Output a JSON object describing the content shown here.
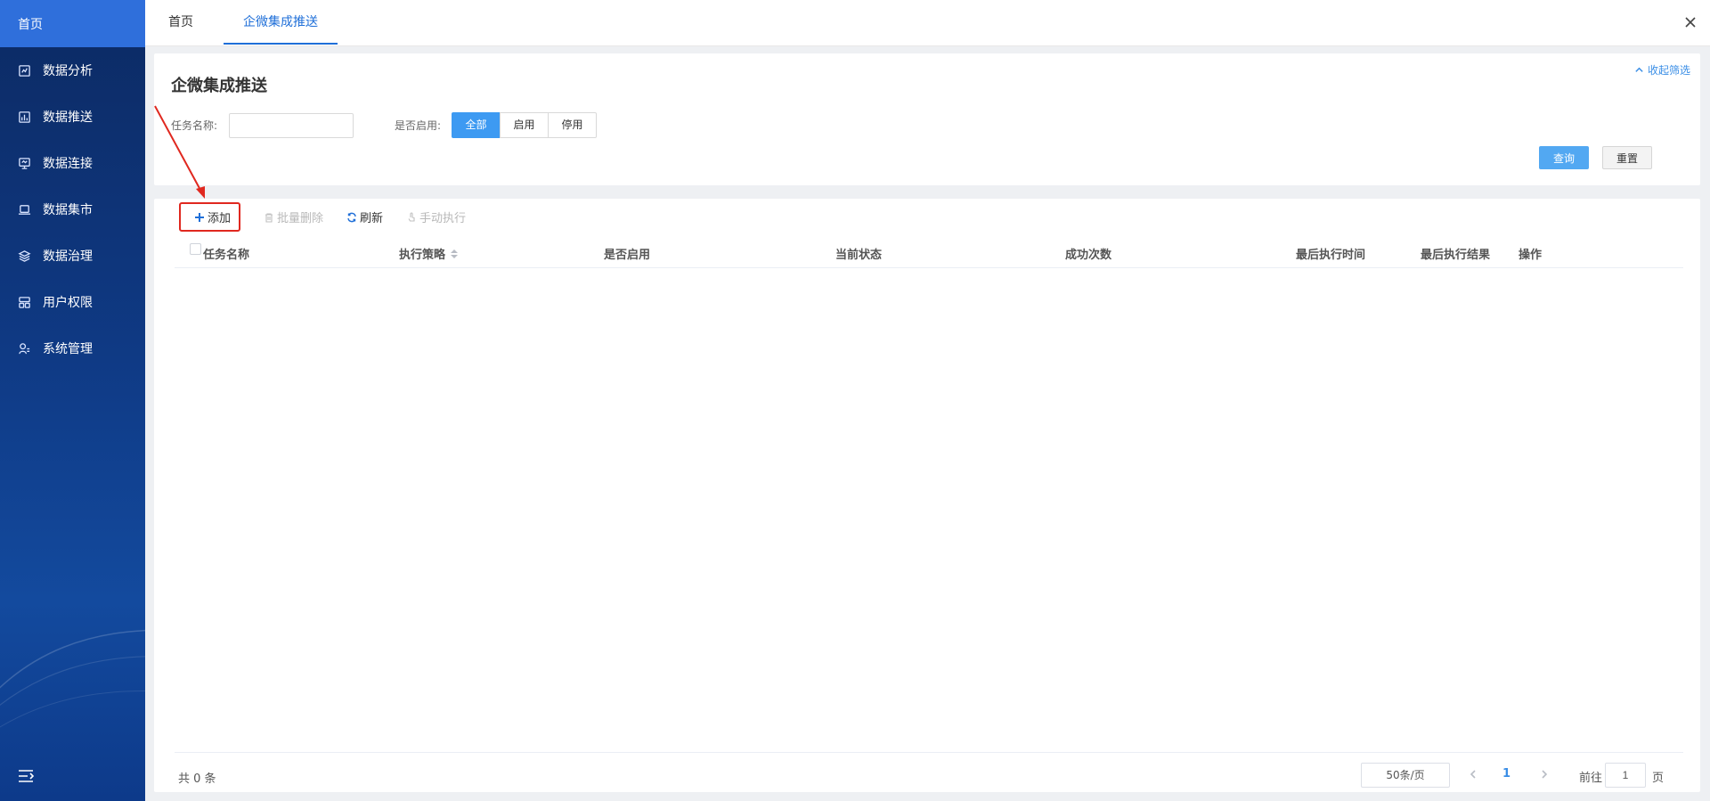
{
  "sidebar": {
    "home_label": "首页",
    "items": [
      {
        "label": "数据分析",
        "icon": "chart-analysis-icon"
      },
      {
        "label": "数据推送",
        "icon": "bar-chart-icon"
      },
      {
        "label": "数据连接",
        "icon": "monitor-link-icon"
      },
      {
        "label": "数据集市",
        "icon": "laptop-icon"
      },
      {
        "label": "数据治理",
        "icon": "layers-icon"
      },
      {
        "label": "用户权限",
        "icon": "user-permission-icon"
      },
      {
        "label": "系统管理",
        "icon": "system-settings-icon"
      }
    ]
  },
  "tabs": [
    {
      "label": "首页",
      "active": false
    },
    {
      "label": "企微集成推送",
      "active": true
    }
  ],
  "filter": {
    "title": "企微集成推送",
    "collapse_label": "收起筛选",
    "task_name_label": "任务名称:",
    "task_name_value": "",
    "enabled_label": "是否启用:",
    "enabled_options": [
      "全部",
      "启用",
      "停用"
    ],
    "enabled_selected": "全部",
    "query_label": "查询",
    "reset_label": "重置"
  },
  "toolbar": {
    "add_label": "添加",
    "batch_delete_label": "批量删除",
    "refresh_label": "刷新",
    "manual_run_label": "手动执行"
  },
  "table": {
    "columns": [
      "任务名称",
      "执行策略",
      "是否启用",
      "当前状态",
      "成功次数",
      "最后执行时间",
      "最后执行结果",
      "操作"
    ],
    "rows": []
  },
  "pagination": {
    "total_text": "共 0 条",
    "page_size": "50条/页",
    "current_page": "1",
    "goto_label": "前往",
    "goto_value": "1",
    "goto_suffix": "页"
  },
  "colors": {
    "primary": "#3d9af2",
    "active_tab": "#1f6fd8",
    "highlight_box": "#e0281f",
    "sidebar_home": "#2f6fdb"
  }
}
